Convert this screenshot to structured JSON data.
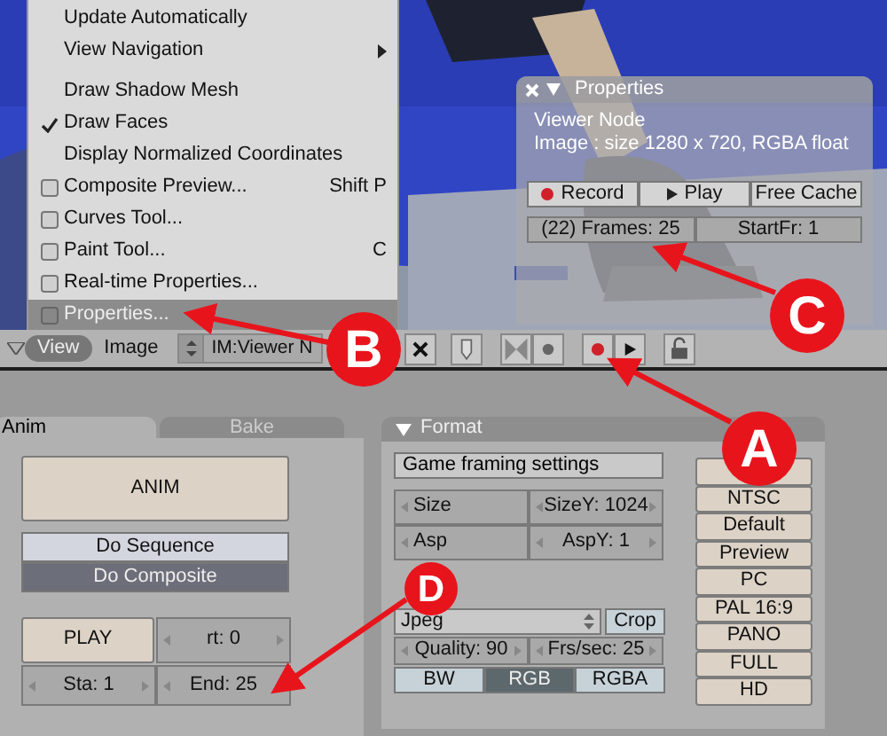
{
  "menu": {
    "items": [
      {
        "label": "Update Automatically",
        "kind": "plain",
        "selected": false
      },
      {
        "label": "View Navigation",
        "kind": "submenu",
        "selected": false
      },
      {
        "kind": "separator"
      },
      {
        "label": "Draw Shadow Mesh",
        "kind": "tick",
        "checked": false,
        "selected": false
      },
      {
        "label": "Draw Faces",
        "kind": "tick",
        "checked": true,
        "selected": false
      },
      {
        "label": "Display Normalized Coordinates",
        "kind": "tick",
        "checked": false,
        "selected": false
      },
      {
        "label": "Composite Preview...",
        "kind": "checkbox",
        "shortcut": "Shift P",
        "selected": false
      },
      {
        "label": "Curves Tool...",
        "kind": "checkbox",
        "selected": false
      },
      {
        "label": "Paint Tool...",
        "kind": "checkbox",
        "shortcut": "C",
        "selected": false
      },
      {
        "label": "Real-time Properties...",
        "kind": "checkbox",
        "selected": false
      },
      {
        "label": "Properties...",
        "kind": "checkbox",
        "selected": true
      }
    ]
  },
  "properties_panel": {
    "title": "Properties",
    "lines": [
      "Viewer Node",
      "Image : size 1280 x 720, RGBA float"
    ],
    "buttons": [
      {
        "label": "Record",
        "kind": "record"
      },
      {
        "label": "Play",
        "kind": "play"
      },
      {
        "label": "Free Cache",
        "kind": "plain"
      }
    ],
    "fields": [
      "(22) Frames: 25",
      "StartFr: 1"
    ]
  },
  "header": {
    "menus": [
      {
        "label": "View",
        "selected": true
      },
      {
        "label": "Image",
        "selected": false
      }
    ],
    "image_selector": "IM:Viewer N"
  },
  "anim_panel": {
    "tabs": [
      {
        "label": "Anim",
        "selected": true
      },
      {
        "label": "Bake",
        "selected": false
      }
    ],
    "anim_button": "ANIM",
    "pipeline": [
      {
        "label": "Do Sequence",
        "selected": false
      },
      {
        "label": "Do Composite",
        "selected": true
      }
    ],
    "play_button": "PLAY",
    "fields": [
      "rt: 0",
      "Sta: 1",
      "End: 25"
    ]
  },
  "format_panel": {
    "title": "Format",
    "game_framing": "Game framing settings",
    "size_fields": [
      "Size",
      "SizeY: 1024",
      "Asp",
      "AspY: 1"
    ],
    "file_type": "Jpeg",
    "crop": "Crop",
    "fields": [
      "Quality: 90",
      "Frs/sec: 25"
    ],
    "color_modes": [
      {
        "label": "BW",
        "selected": false
      },
      {
        "label": "RGB",
        "selected": true
      },
      {
        "label": "RGBA",
        "selected": false
      }
    ],
    "presets": [
      "NTSC",
      "Default",
      "Preview",
      "PC",
      "PAL 16:9",
      "PANO",
      "FULL",
      "HD"
    ]
  },
  "callouts": [
    {
      "label": "A"
    },
    {
      "label": "B"
    },
    {
      "label": "C"
    },
    {
      "label": "D"
    }
  ]
}
